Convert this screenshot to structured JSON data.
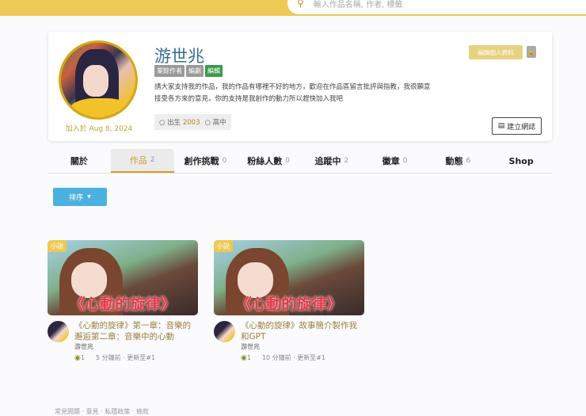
{
  "search": {
    "placeholder": "輸入作品名稱, 作者, 標籤"
  },
  "profile": {
    "name": "游世兆",
    "tags": [
      "業餘作者",
      "編劇",
      "編輯"
    ],
    "bio": "請大家支持我的作品，我的作品有哪裡不好的地方，歡迎在作品區留言批評與指教，我很願意接受各方來的意見，你的支持是我創作的動力所以趕快加入我吧",
    "joined": "加入於 Aug 8, 2024",
    "birth_label": "出生",
    "birth_year": "2003",
    "school": "高中",
    "edit_label": "編輯個人資料",
    "blog_label": "建立網誌"
  },
  "tabs": [
    {
      "label": "關於",
      "count": ""
    },
    {
      "label": "作品",
      "count": "2"
    },
    {
      "label": "創作挑戰",
      "count": "0"
    },
    {
      "label": "粉絲人數",
      "count": "0"
    },
    {
      "label": "追蹤中",
      "count": "2"
    },
    {
      "label": "徽章",
      "count": "0"
    },
    {
      "label": "動態",
      "count": "6"
    },
    {
      "label": "Shop",
      "count": ""
    }
  ],
  "sort_label": "排序",
  "works": [
    {
      "badge": "小說",
      "cover_text": "《心動的旋律》",
      "title": "《心動的旋律》第一章：音樂的邂逅第二章：音樂中的心動",
      "author": "游世兆",
      "views": "1",
      "updated": "5 分鐘前 · 更新至#1"
    },
    {
      "badge": "小說",
      "cover_text": "《心動的旋律》",
      "title": "《心動的旋律》故事簡介製作我和GPT",
      "author": "游世兆",
      "views": "1",
      "updated": "10 分鐘前 · 更新至#1"
    }
  ],
  "footer": "常見問題 · 意見 · 私隱政策 · 條款"
}
